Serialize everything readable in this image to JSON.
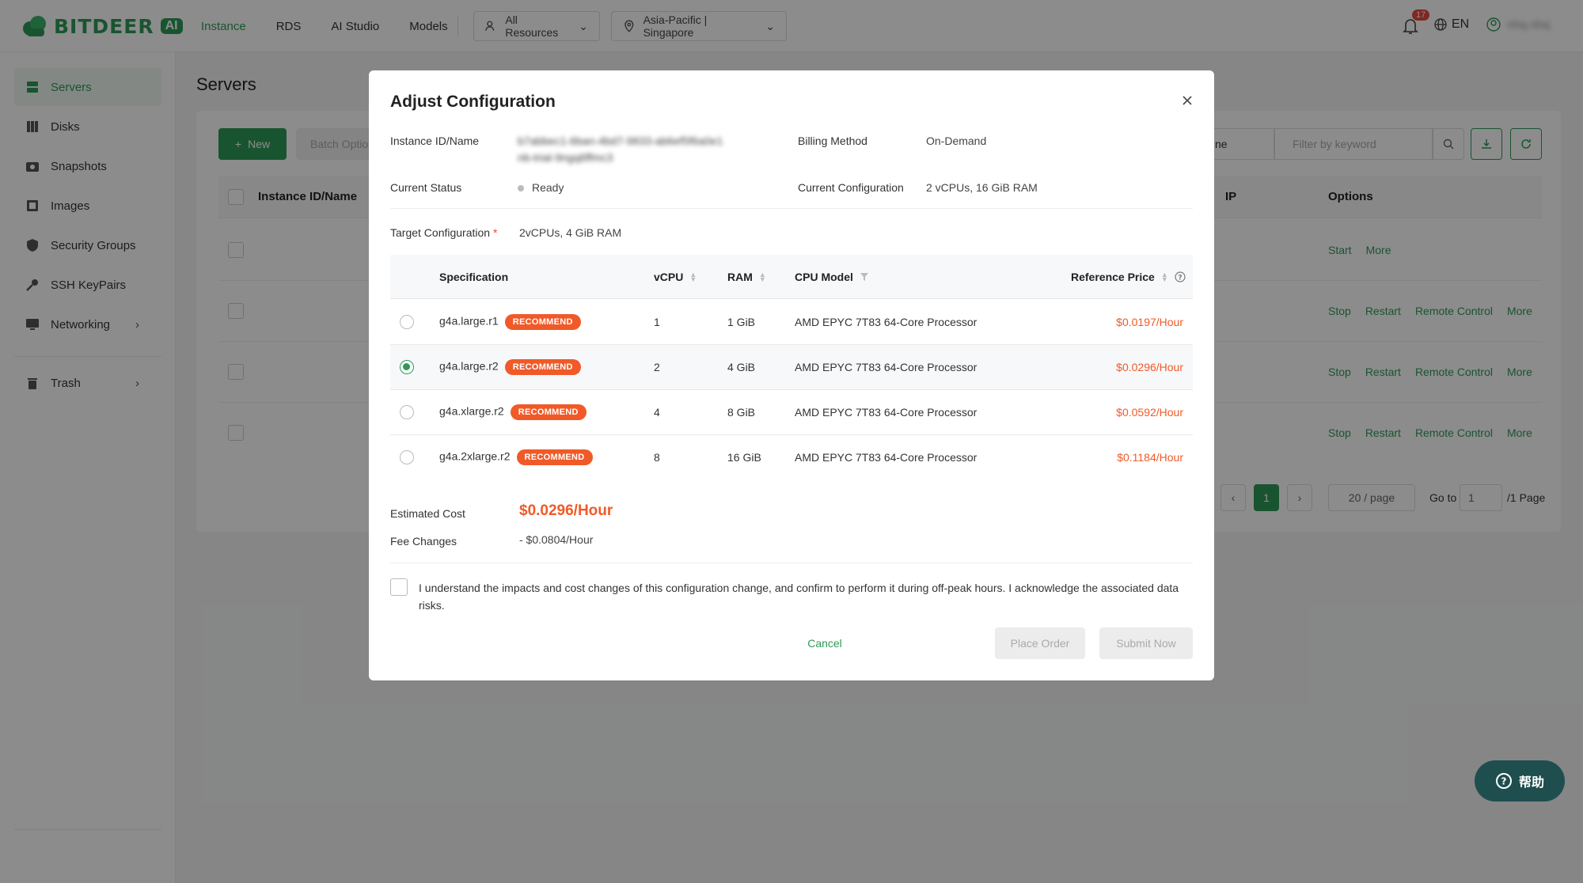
{
  "brand": {
    "name": "BITDEER",
    "ai": "AI"
  },
  "nav": {
    "items": [
      "Instance",
      "RDS",
      "AI Studio",
      "Models"
    ],
    "active": "Instance"
  },
  "resources": {
    "label": "All Resources"
  },
  "region": {
    "label": "Asia-Pacific | Singapore"
  },
  "notifications": {
    "count": "17"
  },
  "language": {
    "label": "EN"
  },
  "user": {
    "name": "nhq.nhq"
  },
  "sidebar": {
    "items": [
      {
        "label": "Servers",
        "icon": "server-icon"
      },
      {
        "label": "Disks",
        "icon": "disk-icon"
      },
      {
        "label": "Snapshots",
        "icon": "camera-icon"
      },
      {
        "label": "Images",
        "icon": "image-icon"
      },
      {
        "label": "Security Groups",
        "icon": "shield-icon"
      },
      {
        "label": "SSH KeyPairs",
        "icon": "key-icon"
      },
      {
        "label": "Networking",
        "icon": "network-icon"
      },
      {
        "label": "Trash",
        "icon": "trash-icon"
      }
    ]
  },
  "page": {
    "title": "Servers"
  },
  "toolbar": {
    "new_label": "New",
    "batch_label": "Batch Optio",
    "filter_select": "ne",
    "filter_placeholder": "Filter by keyword"
  },
  "table": {
    "headers": {
      "instance": "Instance ID/Name",
      "ip": "IP",
      "options": "Options"
    },
    "rows": [
      {
        "ops": [
          "Start",
          "More"
        ]
      },
      {
        "ops": [
          "Stop",
          "Restart",
          "Remote Control",
          "More"
        ]
      },
      {
        "ops": [
          "Stop",
          "Restart",
          "Remote Control",
          "More"
        ]
      },
      {
        "ops": [
          "Stop",
          "Restart",
          "Remote Control",
          "More"
        ]
      }
    ]
  },
  "pagination": {
    "current": "1",
    "page_size": "20 / page",
    "goto_label": "Go to",
    "goto_value": "1",
    "total_pages": "/1 Page"
  },
  "modal": {
    "title": "Adjust Configuration",
    "instance_label": "Instance ID/Name",
    "instance_value_1": "b7abbec1-6ban-4bd7-9833-ab6ef5f6a0e1",
    "instance_value_2": "nb-trial-9ngq6ffmc3",
    "billing_label": "Billing Method",
    "billing_value": "On-Demand",
    "status_label": "Current Status",
    "status_value": "Ready",
    "current_config_label": "Current Configuration",
    "current_config_value": "2 vCPUs, 16 GiB RAM",
    "target_label": "Target Configuration",
    "target_required": "*",
    "target_value": "2vCPUs, 4 GiB RAM",
    "spec_headers": {
      "spec": "Specification",
      "vcpu": "vCPU",
      "ram": "RAM",
      "cpu_model": "CPU Model",
      "price": "Reference Price"
    },
    "specs": [
      {
        "name": "g4a.large.r1",
        "tag": "RECOMMEND",
        "vcpu": "1",
        "ram": "1 GiB",
        "cpu": "AMD EPYC 7T83 64-Core Processor",
        "price": "$0.0197/Hour",
        "selected": false
      },
      {
        "name": "g4a.large.r2",
        "tag": "RECOMMEND",
        "vcpu": "2",
        "ram": "4 GiB",
        "cpu": "AMD EPYC 7T83 64-Core Processor",
        "price": "$0.0296/Hour",
        "selected": true
      },
      {
        "name": "g4a.xlarge.r2",
        "tag": "RECOMMEND",
        "vcpu": "4",
        "ram": "8 GiB",
        "cpu": "AMD EPYC 7T83 64-Core Processor",
        "price": "$0.0592/Hour",
        "selected": false
      },
      {
        "name": "g4a.2xlarge.r2",
        "tag": "RECOMMEND",
        "vcpu": "8",
        "ram": "16 GiB",
        "cpu": "AMD EPYC 7T83 64-Core Processor",
        "price": "$0.1184/Hour",
        "selected": false
      }
    ],
    "estimated_label": "Estimated Cost",
    "estimated_value": "$0.0296/Hour",
    "fee_label": "Fee Changes",
    "fee_value": "- $0.0804/Hour",
    "agree_text": "I understand the impacts and cost changes of this configuration change, and confirm to perform it during off-peak hours. I acknowledge the associated data risks.",
    "cancel_label": "Cancel",
    "place_label": "Place Order",
    "submit_label": "Submit Now"
  },
  "help": {
    "label": "帮助"
  },
  "colors": {
    "accent": "#2f9a58",
    "price": "#f05a28",
    "help_bg": "#1f4e4f"
  }
}
